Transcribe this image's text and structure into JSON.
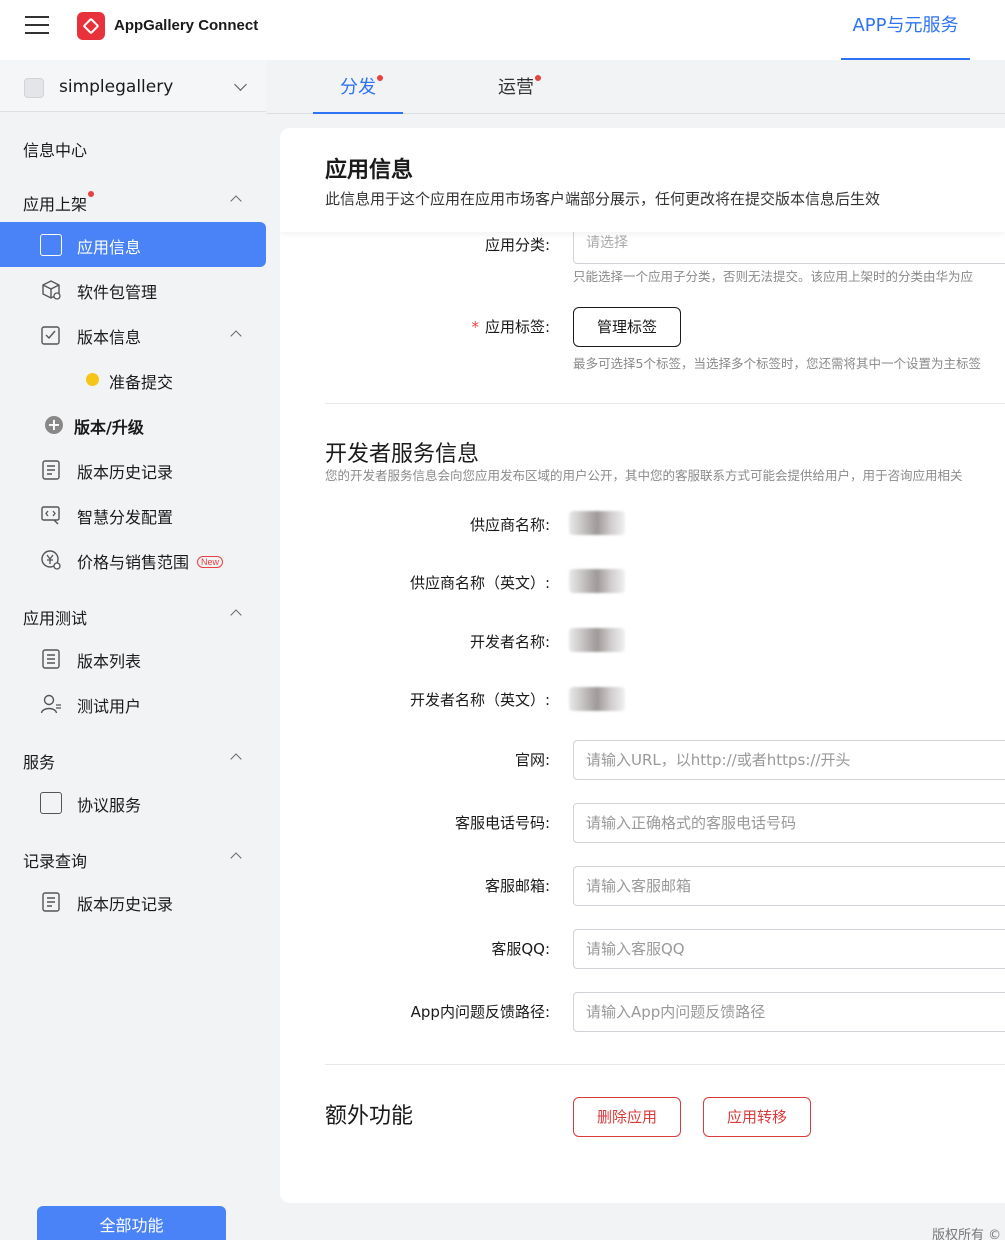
{
  "header": {
    "brand": "AppGallery Connect",
    "nav_label": "APP与元服务"
  },
  "sidebar": {
    "app_name": "simplegallery",
    "info_center": "信息中心",
    "section_release": "应用上架",
    "items": {
      "app_info": "应用信息",
      "package_mgmt": "软件包管理",
      "version_info": "版本信息",
      "ready_submit": "准备提交",
      "version_upgrade": "版本/升级",
      "version_history": "版本历史记录",
      "smart_dist": "智慧分发配置",
      "price_range": "价格与销售范围",
      "new_badge": "New"
    },
    "section_test": "应用测试",
    "test_items": {
      "version_list": "版本列表",
      "test_users": "测试用户"
    },
    "section_service": "服务",
    "service_items": {
      "agreement": "协议服务"
    },
    "section_records": "记录查询",
    "record_items": {
      "history": "版本历史记录"
    },
    "all_functions": "全部功能"
  },
  "tabs": {
    "distribute": "分发",
    "operate": "运营"
  },
  "main": {
    "title": "应用信息",
    "description": "此信息用于这个应用在应用市场客户端部分展示，任何更改将在提交版本信息后生效",
    "category_label": "应用分类:",
    "category_placeholder": "请选择",
    "category_hint": "只能选择一个应用子分类，否则无法提交。该应用上架时的分类由华为应",
    "tag_label": "应用标签:",
    "tag_button": "管理标签",
    "tag_hint": "最多可选择5个标签，当选择多个标签时，您还需将其中一个设置为主标签",
    "dev_section_title": "开发者服务信息",
    "dev_section_desc": "您的开发者服务信息会向您应用发布区域的用户公开，其中您的客服联系方式可能会提供给用户，用于咨询应用相关",
    "fields": {
      "supplier": "供应商名称:",
      "supplier_en": "供应商名称（英文）:",
      "developer": "开发者名称:",
      "developer_en": "开发者名称（英文）:",
      "website": "官网:",
      "website_ph": "请输入URL，以http://或者https://开头",
      "phone": "客服电话号码:",
      "phone_ph": "请输入正确格式的客服电话号码",
      "email": "客服邮箱:",
      "email_ph": "请输入客服邮箱",
      "qq": "客服QQ:",
      "qq_ph": "请输入客服QQ",
      "feedback": "App内问题反馈路径:",
      "feedback_ph": "请输入App内问题反馈路径"
    },
    "extra_title": "额外功能",
    "delete_app": "删除应用",
    "transfer_app": "应用转移"
  },
  "footer": {
    "copyright": "版权所有 ©"
  },
  "colors": {
    "accent": "#2f73f5",
    "active_bg": "#4a83f7",
    "danger": "#d93a3a"
  }
}
